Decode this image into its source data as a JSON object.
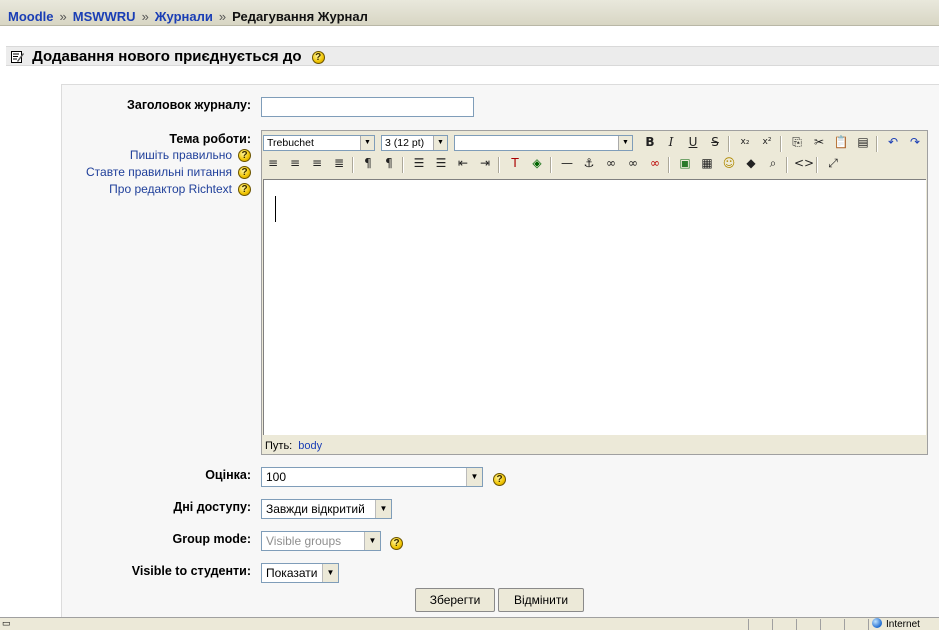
{
  "breadcrumb": {
    "items": [
      "Moodle",
      "MSWWRU",
      "Журнали"
    ],
    "separator": "»",
    "current": "Редагування Журнал"
  },
  "heading": {
    "title": "Додавання нового приєднується до",
    "help": "?"
  },
  "form": {
    "title_label": "Заголовок журналу:",
    "title_value": "",
    "topic_label": "Тема роботи:",
    "help_links": [
      "Пишіть правильно",
      "Ставте правильні питання",
      "Про редактор Richtext"
    ],
    "editor": {
      "font": "Trebuchet",
      "size": "3 (12 pt)",
      "style": "",
      "path_label": "Путь:",
      "path_value": "body"
    },
    "grade_label": "Оцінка:",
    "grade_value": "100",
    "days_label": "Дні доступу:",
    "days_value": "Завжди відкритий",
    "group_label": "Group mode:",
    "group_value": "Visible groups",
    "visible_label": "Visible to студенти:",
    "visible_value": "Показати"
  },
  "buttons": {
    "save": "Зберегти",
    "cancel": "Відмінити"
  },
  "statusbar": {
    "zone": "Internet"
  },
  "colors": {
    "link": "#1a3eb5",
    "navbar_bg": "#e0dfcf",
    "panel_bg": "#f7f7f7",
    "chrome": "#ece9d8"
  }
}
